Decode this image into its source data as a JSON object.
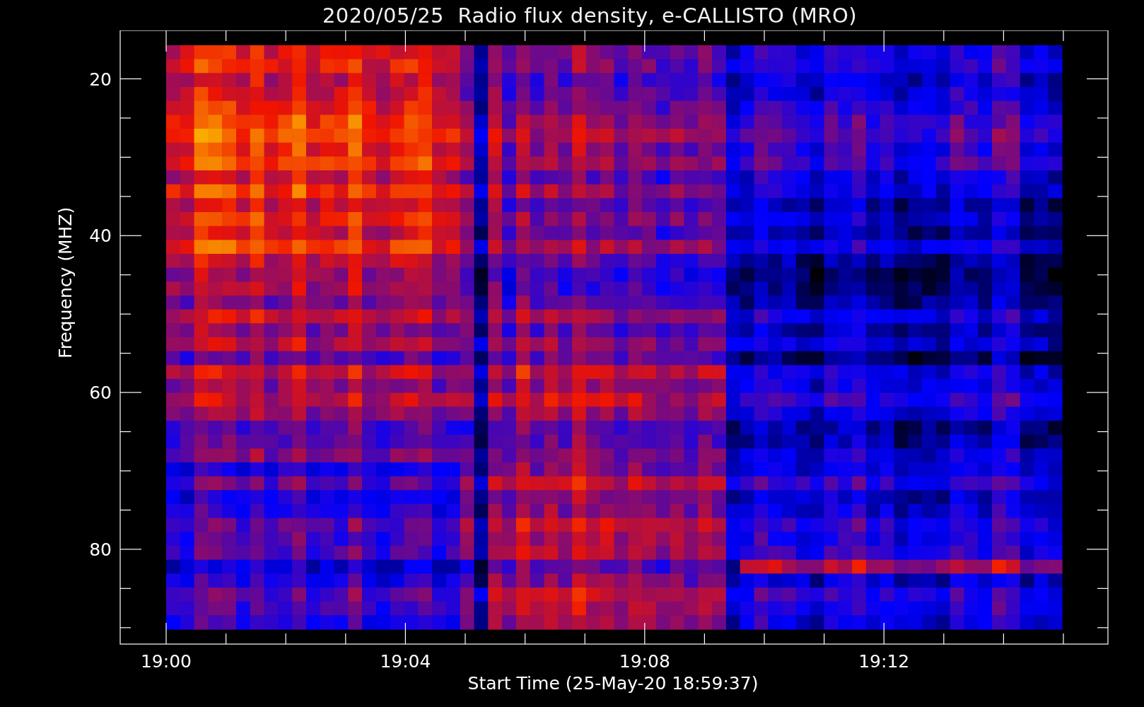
{
  "title": "2020/05/25  Radio flux density, e-CALLISTO (MRO)",
  "y_axis": {
    "label": "Frequency (MHZ)",
    "ticks": [
      "20",
      "40",
      "60",
      "80"
    ]
  },
  "x_axis": {
    "label": "Start Time (25-May-20 18:59:37)",
    "ticks": [
      "19:00",
      "19:04",
      "19:08",
      "19:12"
    ]
  }
}
